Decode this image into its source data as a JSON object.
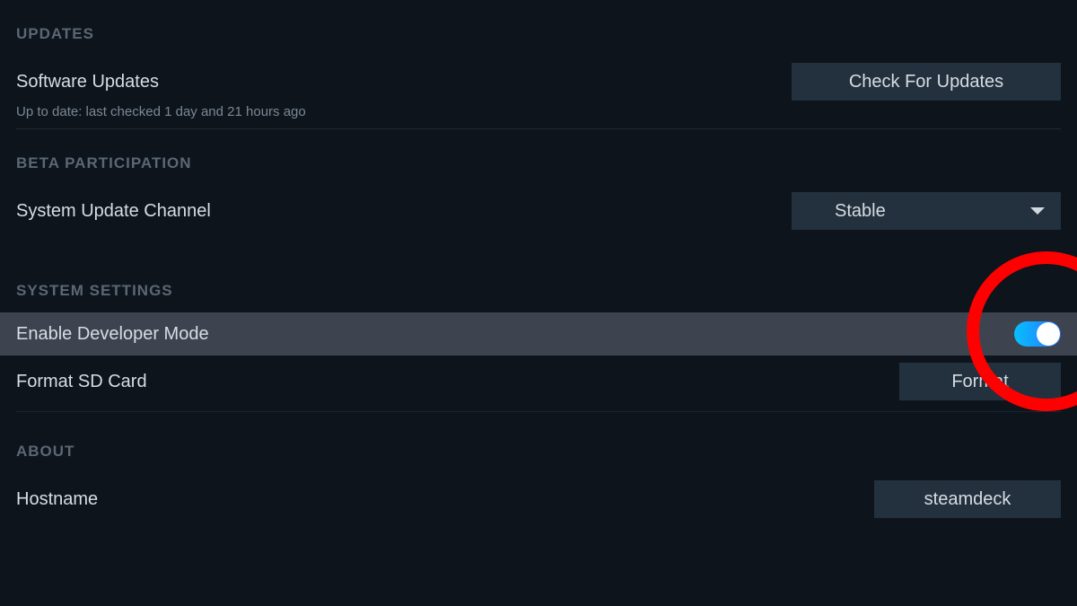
{
  "updates": {
    "header": "UPDATES",
    "software_updates_label": "Software Updates",
    "check_button": "Check For Updates",
    "status_text": "Up to date: last checked 1 day and 21 hours ago"
  },
  "beta": {
    "header": "BETA PARTICIPATION",
    "channel_label": "System Update Channel",
    "channel_value": "Stable"
  },
  "system": {
    "header": "SYSTEM SETTINGS",
    "dev_mode_label": "Enable Developer Mode",
    "dev_mode_enabled": true,
    "format_sd_label": "Format SD Card",
    "format_button": "Format"
  },
  "about": {
    "header": "ABOUT",
    "hostname_label": "Hostname",
    "hostname_value": "steamdeck"
  }
}
